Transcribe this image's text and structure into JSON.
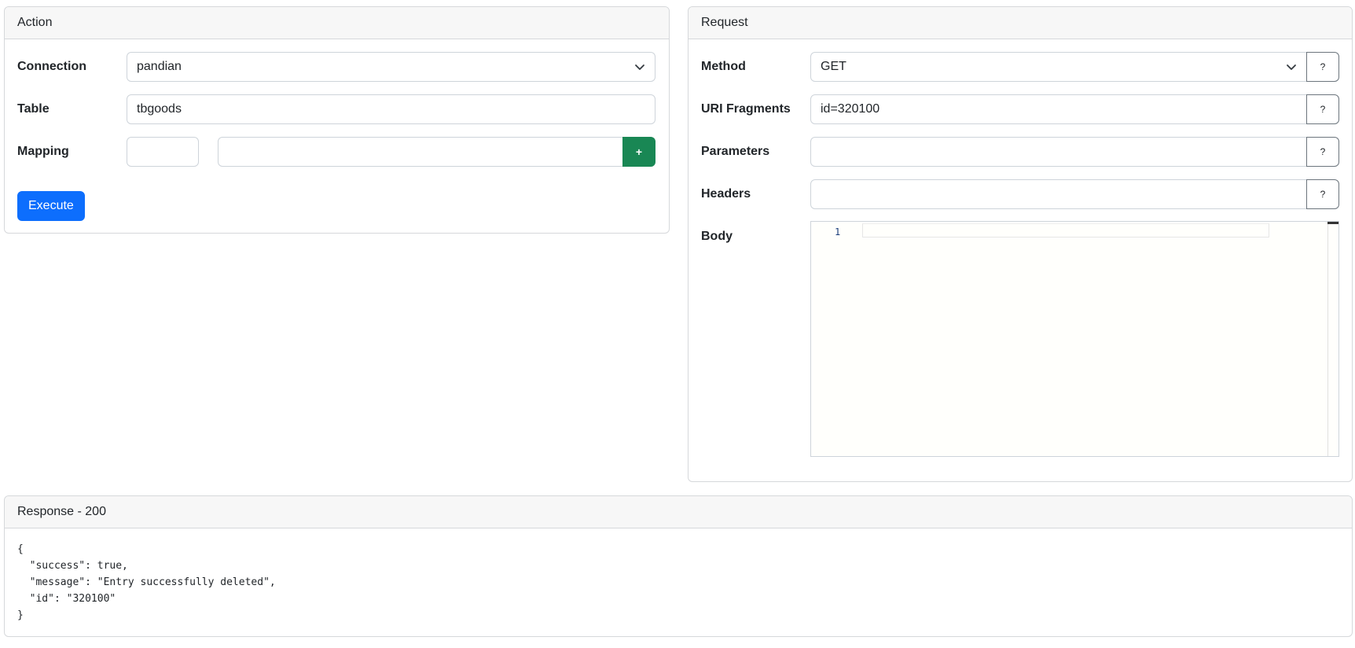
{
  "action": {
    "header": "Action",
    "connection_label": "Connection",
    "connection_value": "pandian",
    "table_label": "Table",
    "table_value": "tbgoods",
    "mapping_label": "Mapping",
    "mapping_key_value": "",
    "mapping_value_value": "",
    "add_mapping_label": "+",
    "execute_label": "Execute"
  },
  "request": {
    "header": "Request",
    "method_label": "Method",
    "method_value": "GET",
    "uri_label": "URI Fragments",
    "uri_value": "id=320100",
    "params_label": "Parameters",
    "params_value": "",
    "headers_label": "Headers",
    "headers_value": "",
    "body_label": "Body",
    "help_label": "?",
    "body_line_number": "1"
  },
  "response": {
    "header": "Response - 200",
    "body": "{\n  \"success\": true,\n  \"message\": \"Entry successfully deleted\",\n  \"id\": \"320100\"\n}"
  }
}
